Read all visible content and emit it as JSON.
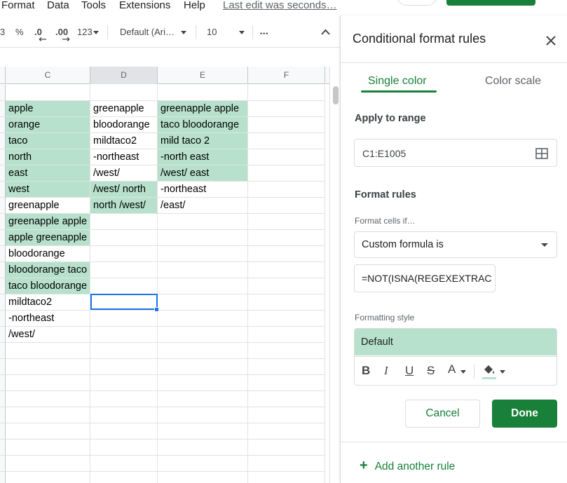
{
  "menu": {
    "items": [
      "Format",
      "Data",
      "Tools",
      "Extensions",
      "Help"
    ],
    "last_edit": "Last edit was seconds…"
  },
  "toolbar": {
    "currency_suffix": "3",
    "percent": "%",
    "decrease_decimals": ".0",
    "increase_decimals": ".00",
    "more_formats": "123",
    "font": "Default (Ari…",
    "font_size": "10",
    "more": "•••"
  },
  "sheet": {
    "columns": [
      "C",
      "D",
      "E",
      "F"
    ],
    "active_column": "D",
    "highlight_color": "#b7e1cd",
    "rows": [
      [
        {
          "v": "",
          "hl": false
        },
        {
          "v": "",
          "hl": false
        },
        {
          "v": "",
          "hl": false
        }
      ],
      [
        {
          "v": "apple",
          "hl": true
        },
        {
          "v": "greenapple",
          "hl": false
        },
        {
          "v": "greenapple apple",
          "hl": true
        }
      ],
      [
        {
          "v": "orange",
          "hl": true
        },
        {
          "v": "bloodorange",
          "hl": false
        },
        {
          "v": "taco bloodorange",
          "hl": true
        }
      ],
      [
        {
          "v": "taco",
          "hl": true
        },
        {
          "v": "mildtaco2",
          "hl": false
        },
        {
          "v": "mild taco 2",
          "hl": true
        }
      ],
      [
        {
          "v": "north",
          "hl": true
        },
        {
          "v": "-northeast",
          "hl": false
        },
        {
          "v": "-north east",
          "hl": true
        }
      ],
      [
        {
          "v": "east",
          "hl": true
        },
        {
          "v": "/west/",
          "hl": false
        },
        {
          "v": "/west/ east",
          "hl": true
        }
      ],
      [
        {
          "v": "west",
          "hl": true
        },
        {
          "v": "/west/ north",
          "hl": true
        },
        {
          "v": "-northeast",
          "hl": false
        }
      ],
      [
        {
          "v": "greenapple",
          "hl": false
        },
        {
          "v": "north /west/",
          "hl": true
        },
        {
          "v": "/east/",
          "hl": false
        }
      ],
      [
        {
          "v": "greenapple apple",
          "hl": true
        },
        {
          "v": "",
          "hl": false
        },
        {
          "v": "",
          "hl": false
        }
      ],
      [
        {
          "v": "apple greenapple",
          "hl": true
        },
        {
          "v": "",
          "hl": false
        },
        {
          "v": "",
          "hl": false
        }
      ],
      [
        {
          "v": "bloodorange",
          "hl": false
        },
        {
          "v": "",
          "hl": false
        },
        {
          "v": "",
          "hl": false
        }
      ],
      [
        {
          "v": "bloodorange taco",
          "hl": true
        },
        {
          "v": "",
          "hl": false
        },
        {
          "v": "",
          "hl": false
        }
      ],
      [
        {
          "v": "taco bloodorange",
          "hl": true
        },
        {
          "v": "",
          "hl": false
        },
        {
          "v": "",
          "hl": false
        }
      ],
      [
        {
          "v": "mildtaco2",
          "hl": false
        },
        {
          "v": "",
          "hl": false
        },
        {
          "v": "",
          "hl": false
        }
      ],
      [
        {
          "v": "-northeast",
          "hl": false
        },
        {
          "v": "",
          "hl": false
        },
        {
          "v": "",
          "hl": false
        }
      ],
      [
        {
          "v": "/west/",
          "hl": false
        },
        {
          "v": "",
          "hl": false
        },
        {
          "v": "",
          "hl": false
        }
      ],
      [
        {
          "v": "",
          "hl": false
        },
        {
          "v": "",
          "hl": false
        },
        {
          "v": "",
          "hl": false
        }
      ],
      [
        {
          "v": "",
          "hl": false
        },
        {
          "v": "",
          "hl": false
        },
        {
          "v": "",
          "hl": false
        }
      ],
      [
        {
          "v": "",
          "hl": false
        },
        {
          "v": "",
          "hl": false
        },
        {
          "v": "",
          "hl": false
        }
      ],
      [
        {
          "v": "",
          "hl": false
        },
        {
          "v": "",
          "hl": false
        },
        {
          "v": "",
          "hl": false
        }
      ],
      [
        {
          "v": "",
          "hl": false
        },
        {
          "v": "",
          "hl": false
        },
        {
          "v": "",
          "hl": false
        }
      ],
      [
        {
          "v": "",
          "hl": false
        },
        {
          "v": "",
          "hl": false
        },
        {
          "v": "",
          "hl": false
        }
      ],
      [
        {
          "v": "",
          "hl": false
        },
        {
          "v": "",
          "hl": false
        },
        {
          "v": "",
          "hl": false
        }
      ],
      [
        {
          "v": "",
          "hl": false
        },
        {
          "v": "",
          "hl": false
        },
        {
          "v": "",
          "hl": false
        }
      ],
      [
        {
          "v": "",
          "hl": false
        },
        {
          "v": "",
          "hl": false
        },
        {
          "v": "",
          "hl": false
        }
      ]
    ]
  },
  "panel": {
    "title": "Conditional format rules",
    "tabs": [
      "Single color",
      "Color scale"
    ],
    "active_tab": "Single color",
    "apply_to_range_label": "Apply to range",
    "range_value": "C1:E1005",
    "format_rules_label": "Format rules",
    "cells_if_label": "Format cells if…",
    "condition": "Custom formula is",
    "formula_value": "=NOT(ISNA(REGEXEXTRAC",
    "formatting_style_label": "Formatting style",
    "style_preview": "Default",
    "style_preview_color": "#b7e1cd",
    "style_tools": {
      "bold": "B",
      "italic": "I",
      "underline": "U",
      "strikethrough": "S",
      "text_color": "A"
    },
    "cancel_label": "Cancel",
    "done_label": "Done",
    "add_rule_label": "Add another rule",
    "accent_color": "#188038"
  }
}
